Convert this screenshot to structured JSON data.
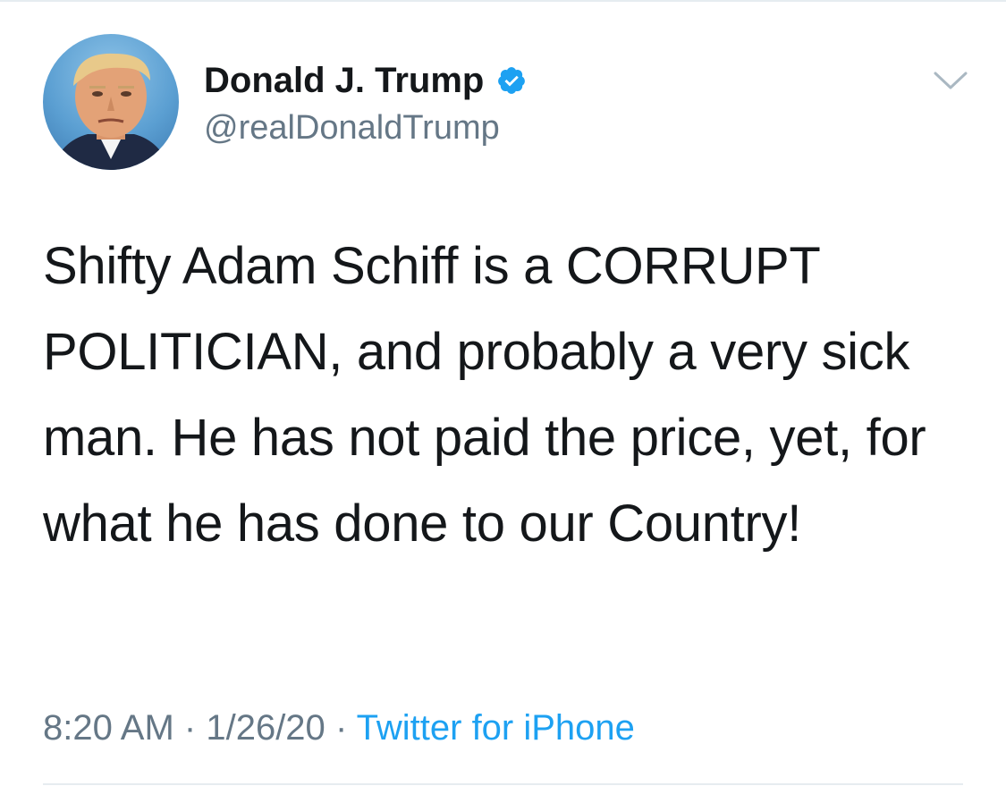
{
  "tweet": {
    "author": {
      "display_name": "Donald J. Trump",
      "handle": "@realDonaldTrump",
      "verified": true,
      "avatar_icon": "profile-photo"
    },
    "text": "Shifty Adam Schiff is a CORRUPT POLITICIAN, and probably a very sick man. He has not paid the price, yet, for what he has done to our Country!",
    "time": "8:20 AM",
    "separator": "·",
    "date": "1/26/20",
    "source": "Twitter for iPhone",
    "menu_icon": "chevron-down-icon"
  },
  "colors": {
    "text_primary": "#14171a",
    "text_secondary": "#657786",
    "accent": "#1da1f2",
    "border": "#e6ecf0"
  }
}
